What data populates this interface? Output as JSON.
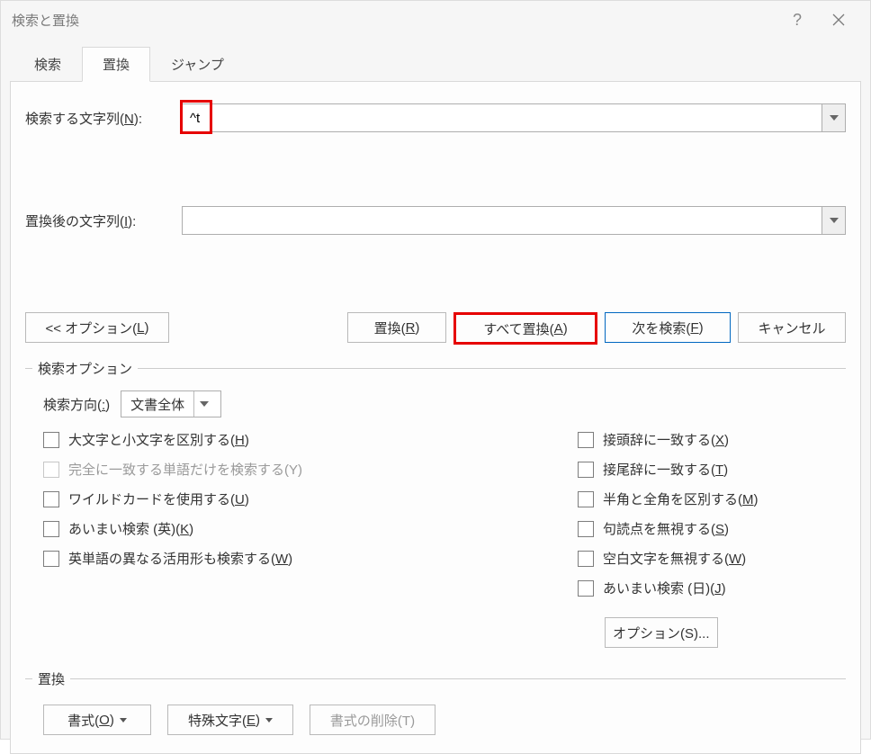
{
  "window": {
    "title": "検索と置換"
  },
  "tabs": {
    "find": "検索",
    "replace": "置換",
    "goto": "ジャンプ"
  },
  "fields": {
    "findLabel": "検索する文字列(",
    "findKey": "N",
    "findLabelEnd": "):",
    "findValue": "^t",
    "replaceLabel": "置換後の文字列(",
    "replaceKey": "I",
    "replaceLabelEnd": "):",
    "replaceValue": ""
  },
  "buttons": {
    "options": "<< オプション(",
    "optionsKey": "L",
    "optionsEnd": ")",
    "replace": "置換(",
    "replaceKey": "R",
    "replaceEnd": ")",
    "replaceAll": "すべて置換(",
    "replaceAllKey": "A",
    "replaceAllEnd": ")",
    "findNext": "次を検索(",
    "findNextKey": "F",
    "findNextEnd": ")",
    "cancel": "キャンセル",
    "moreOptions": "オプション(S)...",
    "format": "書式(",
    "formatKey": "O",
    "formatEnd": ")",
    "special": "特殊文字(",
    "specialKey": "E",
    "specialEnd": ")",
    "noFormat": "書式の削除(T)"
  },
  "search": {
    "groupTitle": "検索オプション",
    "dirLabel": "検索方向(",
    "dirKey": ":",
    "dirLabelEnd": ")",
    "dirValue": "文書全体",
    "left": [
      {
        "label": "大文字と小文字を区別する(",
        "key": "H",
        "end": ")",
        "disabled": false
      },
      {
        "label": "完全に一致する単語だけを検索する(Y)",
        "key": "",
        "end": "",
        "disabled": true
      },
      {
        "label": "ワイルドカードを使用する(",
        "key": "U",
        "end": ")",
        "disabled": false
      },
      {
        "label": "あいまい検索 (英)(",
        "key": "K",
        "end": ")",
        "disabled": false
      },
      {
        "label": "英単語の異なる活用形も検索する(",
        "key": "W",
        "end": ")",
        "disabled": false
      }
    ],
    "right": [
      {
        "label": "接頭辞に一致する(",
        "key": "X",
        "end": ")"
      },
      {
        "label": "接尾辞に一致する(",
        "key": "T",
        "end": ")"
      },
      {
        "label": "半角と全角を区別する(",
        "key": "M",
        "end": ")"
      },
      {
        "label": "句読点を無視する(",
        "key": "S",
        "end": ")"
      },
      {
        "label": "空白文字を無視する(",
        "key": "W",
        "end": ")"
      },
      {
        "label": "あいまい検索 (日)(",
        "key": "J",
        "end": ")"
      }
    ]
  },
  "replaceGroup": {
    "title": "置換"
  }
}
